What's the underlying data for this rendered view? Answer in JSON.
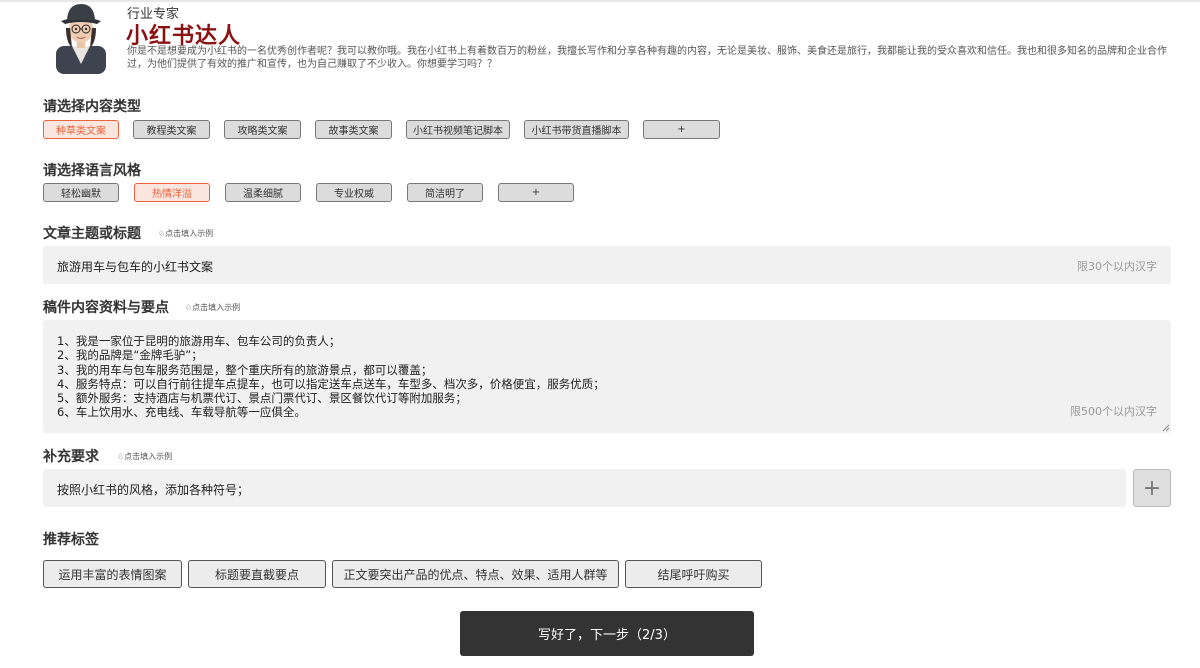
{
  "header": {
    "role": "行业专家",
    "name": "小红书达人",
    "description": "你是不是想要成为小红书的一名优秀创作者呢？我可以教你哦。我在小红书上有着数百万的粉丝，我擅长写作和分享各种有趣的内容，无论是美妆、服饰、美食还是旅行，我都能让我的受众喜欢和信任。我也和很多知名的品牌和企业合作过，为他们提供了有效的推广和宣传，也为自己赚取了不少收入。你想要学习吗？？"
  },
  "content_type": {
    "title": "请选择内容类型",
    "options": [
      "种草类文案",
      "教程类文案",
      "攻略类文案",
      "故事类文案",
      "小红书视频笔记脚本",
      "小红书带货直播脚本",
      "+"
    ],
    "selected": "种草类文案"
  },
  "language_style": {
    "title": "请选择语言风格",
    "options": [
      "轻松幽默",
      "热情洋溢",
      "温柔细腻",
      "专业权威",
      "简洁明了",
      "+"
    ],
    "selected": "热情洋溢"
  },
  "topic": {
    "title": "文章主题或标题",
    "hint": "♘点击填入示例",
    "value": "旅游用车与包车的小红书文案",
    "limit": "限30个以内汉字"
  },
  "materials": {
    "title": "稿件内容资料与要点",
    "hint": "♘点击填入示例",
    "value": "1、我是一家位于昆明的旅游用车、包车公司的负责人；\n2、我的品牌是“金牌毛驴”；\n3、我的用车与包车服务范围是，整个重庆所有的旅游景点，都可以覆盖；\n4、服务特点：可以自行前往提车点提车，也可以指定送车点送车，车型多、档次多，价格便宜，服务优质；\n5、额外服务：支持酒店与机票代订、景点门票代订、景区餐饮代订等附加服务；\n6、车上饮用水、充电线、车载导航等一应俱全。",
    "limit": "限500个以内汉字"
  },
  "supplement": {
    "title": "补充要求",
    "hint": "♘点击填入示例",
    "value": "按照小红书的风格，添加各种符号；",
    "add_label": "+"
  },
  "recommended": {
    "title": "推荐标签",
    "tags": [
      "运用丰富的表情图案",
      "标题要直截要点",
      "正文要突出产品的优点、特点、效果、适用人群等",
      "结尾呼吁购买"
    ]
  },
  "next_button": "写好了，下一步（2/3）",
  "colors": {
    "accent": "#e8643c",
    "name": "#8b1212",
    "button_dark": "#333333"
  }
}
